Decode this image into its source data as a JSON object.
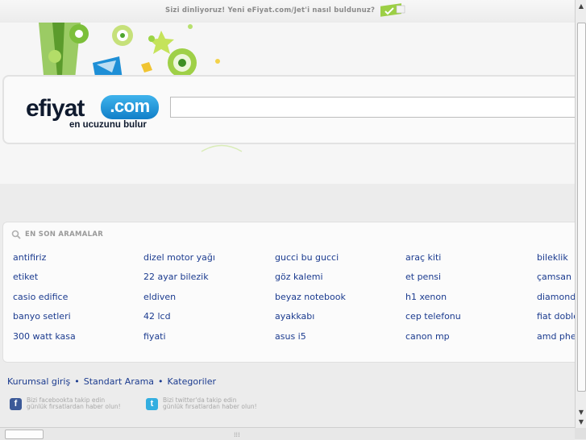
{
  "topbar": {
    "message": "Sizi dinliyoruz! Yeni eFiyat.com/Jet'i nasıl buldunuz?"
  },
  "logo": {
    "text": "efiyat",
    "badge": ".com",
    "tagline": "en ucuzunu bulur"
  },
  "search": {
    "value": ""
  },
  "recent": {
    "title": "EN SON ARAMALAR",
    "columns": [
      [
        "antifiriz",
        "etiket",
        "casio edifice",
        "banyo setleri",
        "300 watt kasa"
      ],
      [
        "dizel motor yağı",
        "22 ayar bilezik",
        "eldiven",
        "42 lcd",
        "fiyati"
      ],
      [
        "gucci bu gucci",
        "göz kalemi",
        "beyaz notebook",
        "ayakkabı",
        "asus i5"
      ],
      [
        "araç kiti",
        "et pensi",
        "h1 xenon",
        "cep telefonu",
        "canon mp"
      ],
      [
        "bileklik",
        "çamsan",
        "diamonds",
        "fiat doblo",
        "amd phen"
      ]
    ]
  },
  "footer": {
    "links": [
      "Kurumsal giriş",
      "Standart Arama",
      "Kategoriler"
    ],
    "separator": "•",
    "facebook": {
      "line1": "Bizi facebookta takip edin",
      "line2": "günlük fırsatlardan haber olun!"
    },
    "twitter": {
      "line1": "Bizi twitter'da takip edin",
      "line2": "günlük fırsatlardan haber olun!"
    }
  },
  "colors": {
    "link": "#1b3b8f",
    "brand_blue": "#1e90d8",
    "muted": "#9a9a9a"
  },
  "icons": [
    "search-icon",
    "facebook-icon",
    "twitter-icon",
    "feedback-flag-icon"
  ]
}
